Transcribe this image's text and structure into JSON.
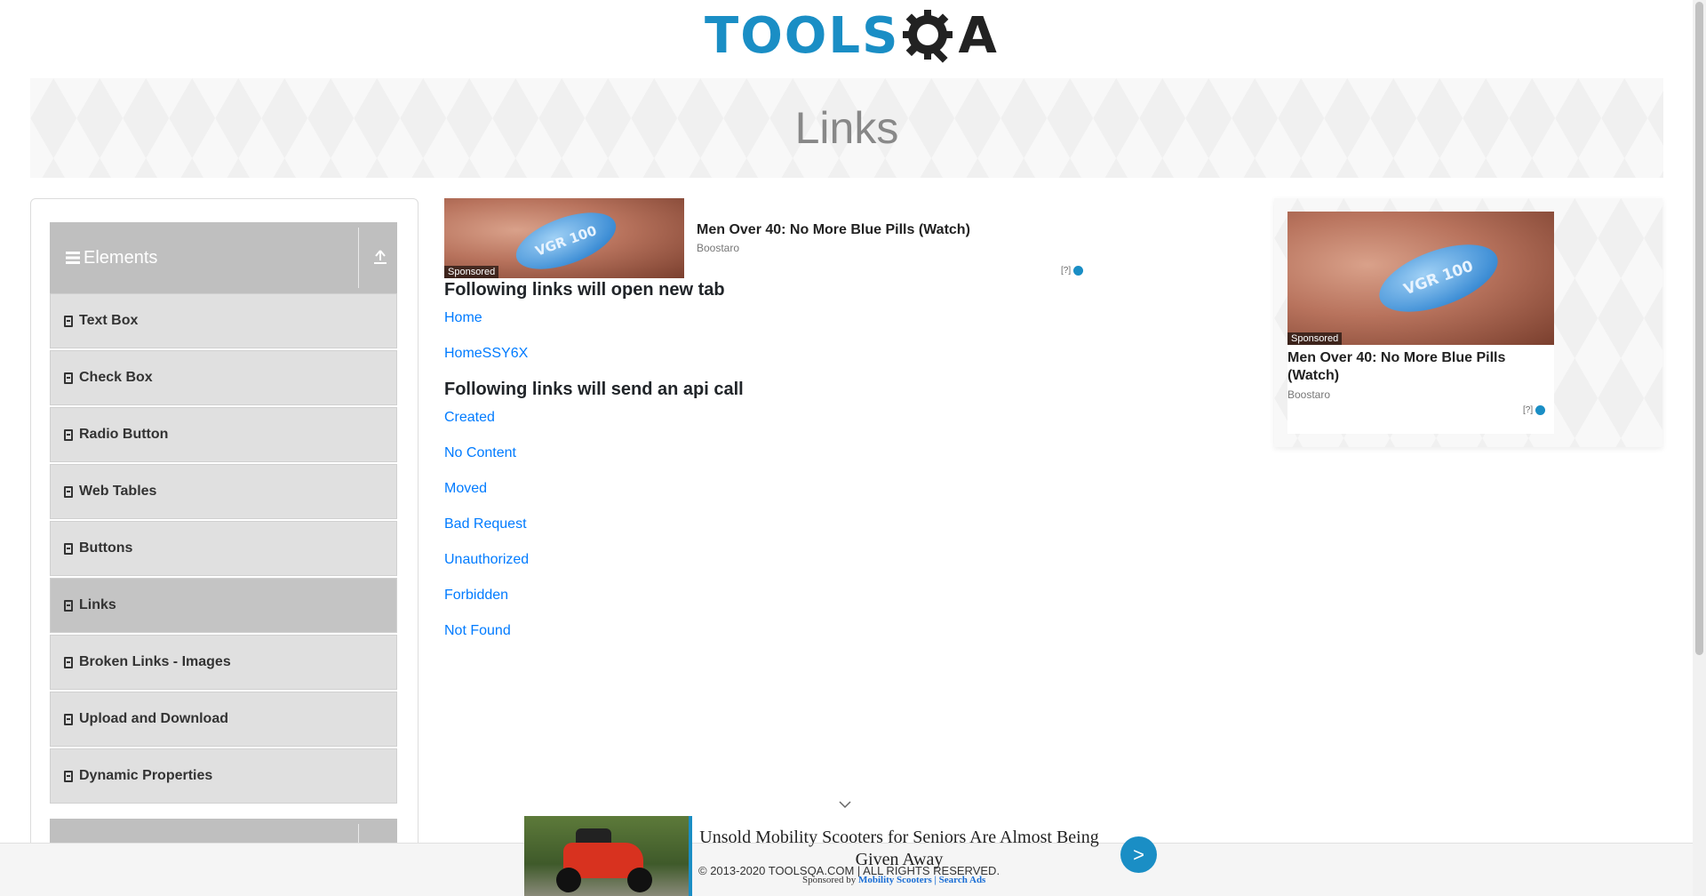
{
  "header": {
    "logo_text": "TOOLS",
    "logo_suffix": "A"
  },
  "banner": {
    "title": "Links"
  },
  "sidebar": {
    "group_title": "Elements",
    "items": [
      {
        "label": "Text Box"
      },
      {
        "label": "Check Box"
      },
      {
        "label": "Radio Button"
      },
      {
        "label": "Web Tables"
      },
      {
        "label": "Buttons"
      },
      {
        "label": "Links",
        "active": true
      },
      {
        "label": "Broken Links - Images"
      },
      {
        "label": "Upload and Download"
      },
      {
        "label": "Dynamic Properties"
      }
    ]
  },
  "ad_top": {
    "pill_text": "VGR 100",
    "sponsored": "Sponsored",
    "title": "Men Over 40: No More Blue Pills (Watch)",
    "source": "Boostaro",
    "adchoice": "[?]"
  },
  "ad_right": {
    "pill_text": "VGR 100",
    "sponsored": "Sponsored",
    "title": "Men Over 40: No More Blue Pills (Watch)",
    "source": "Boostaro",
    "adchoice": "[?]"
  },
  "main": {
    "section1_title": "Following links will open new tab",
    "section1_links": [
      "Home",
      "HomeSSY6X"
    ],
    "section2_title": "Following links will send an api call",
    "section2_links": [
      "Created",
      "No Content",
      "Moved",
      "Bad Request",
      "Unauthorized",
      "Forbidden",
      "Not Found"
    ]
  },
  "bottom_ad": {
    "title": "Unsold Mobility Scooters for Seniors Are Almost Being Given Away",
    "go_label": ">",
    "sponsored_prefix": "Sponsored by",
    "sponsor_name": "Mobility Scooters",
    "search_ads": "| Search Ads"
  },
  "footer": {
    "text": "© 2013-2020 TOOLSQA.COM | ALL RIGHTS RESERVED."
  },
  "colors": {
    "accent": "#1a8ec5",
    "link": "#007bff",
    "menu_bg": "#e0e0e0",
    "menu_active": "#c4c4c4",
    "group_header": "#bfbfbf"
  },
  "icons": [
    "gear-icon",
    "bars-icon",
    "upload-icon",
    "html5-icon",
    "chevron-down-icon",
    "adchoices-icon"
  ]
}
